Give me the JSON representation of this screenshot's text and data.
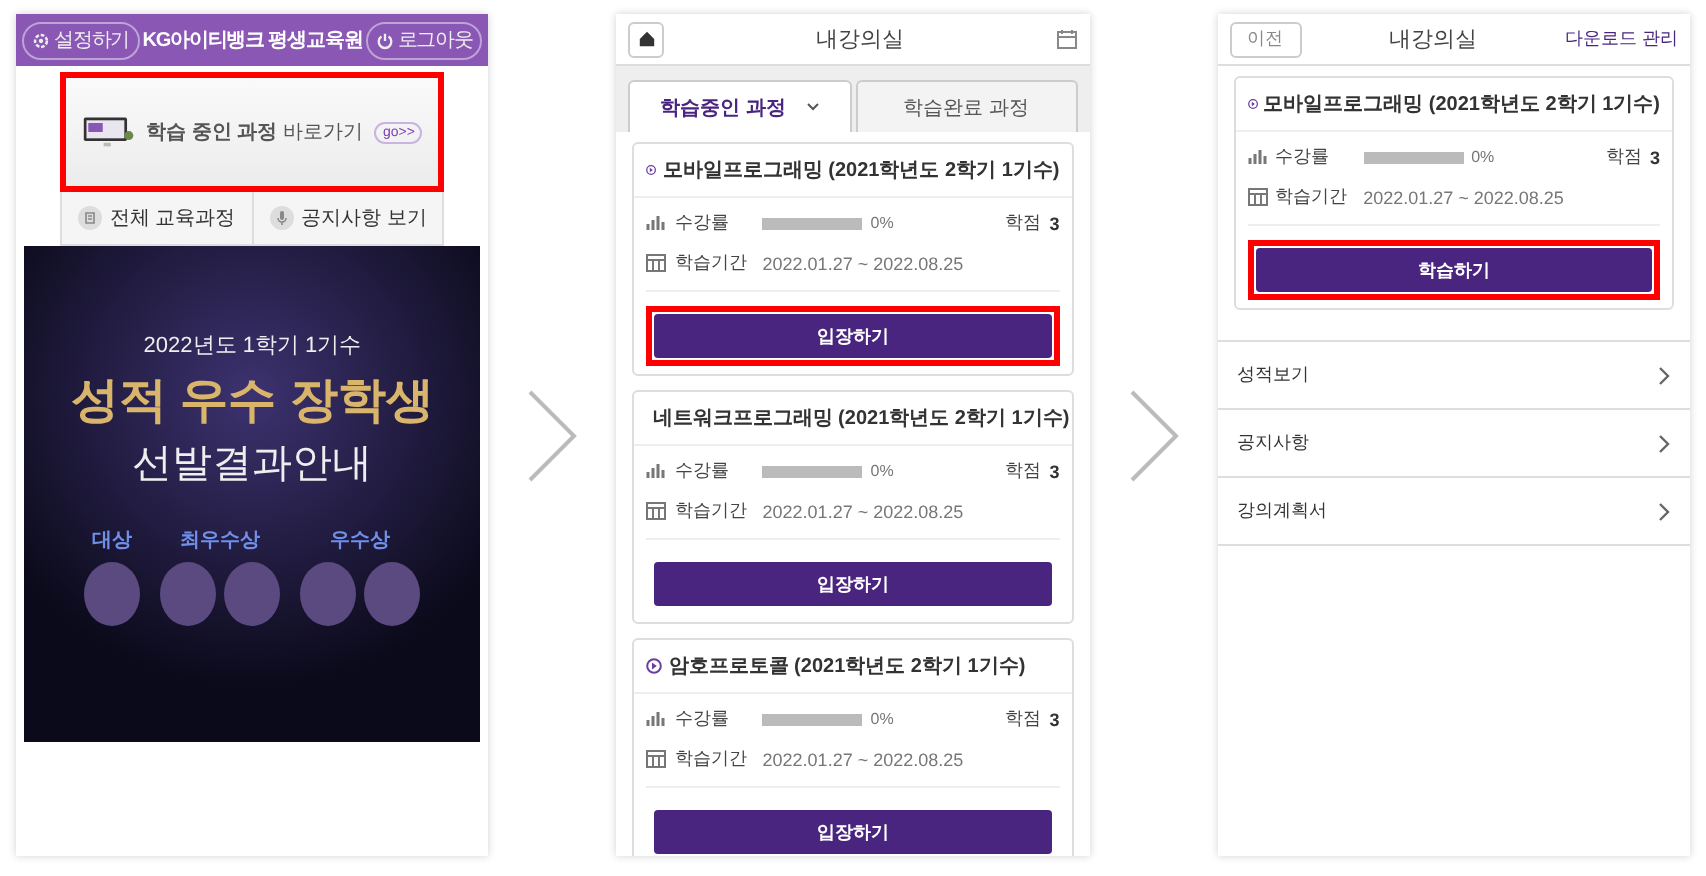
{
  "home_screen": {
    "header": {
      "settings_button": "설정하기",
      "title": "KG아이티뱅크 평생교육원",
      "logout_button": "로그아웃"
    },
    "shortcut": {
      "text": "**학습 중인 과정** 바로가기",
      "badge": "go>>",
      "highlighted": true
    },
    "quick_links": [
      {
        "label": "전체 교육과정",
        "kind": "book"
      },
      {
        "label": "공지사항 보기",
        "kind": "mic"
      }
    ],
    "poster": {
      "subtitle": "2022년도 1학기 1기수",
      "headline": "성적 우수 장학생",
      "caption": "선발결과안내",
      "awards": [
        {
          "label": "대상"
        },
        {
          "label": "최우수상"
        },
        {
          "label": "우수상"
        }
      ]
    }
  },
  "classroom_screen": {
    "title": "내강의실",
    "tabs": [
      {
        "label": "학습중인 과정",
        "selected": true
      },
      {
        "label": "학습완료 과정",
        "selected": false
      }
    ],
    "courses": [
      {
        "title": "모바일프로그래밍 (2021학년도 2학기 1기수)",
        "progress_label": "수강률",
        "level": 0,
        "reading": "0%",
        "credit_label": "학점",
        "credit": "3",
        "period_label": "학습기간",
        "period": "2022.01.27 ~ 2022.08.25",
        "button": "입장하기",
        "highlighted": true
      },
      {
        "title": "네트워크프로그래밍 (2021학년도 2학기 1기수)",
        "progress_label": "수강률",
        "level": 0,
        "reading": "0%",
        "credit_label": "학점",
        "credit": "3",
        "period_label": "학습기간",
        "period": "2022.01.27 ~ 2022.08.25",
        "button": "입장하기",
        "highlighted": false
      },
      {
        "title": "암호프로토콜 (2021학년도 2학기 1기수)",
        "progress_label": "수강률",
        "level": 0,
        "reading": "0%",
        "credit_label": "학점",
        "credit": "3",
        "period_label": "학습기간",
        "period": "2022.01.27 ~ 2022.08.25",
        "button": "입장하기",
        "highlighted": false
      }
    ]
  },
  "course_screen": {
    "back_button": "이전",
    "title": "내강의실",
    "download_link": "다운로드 관리",
    "course": {
      "title": "모바일프로그래밍 (2021학년도 2학기 1기수)",
      "progress_label": "수강률",
      "level": 0,
      "reading": "0%",
      "credit_label": "학점",
      "credit": "3",
      "period_label": "학습기간",
      "period": "2022.01.27 ~ 2022.08.25",
      "button": "학습하기",
      "highlighted": true
    },
    "menu": [
      "성적보기",
      "공지사항",
      "강의계획서"
    ]
  }
}
